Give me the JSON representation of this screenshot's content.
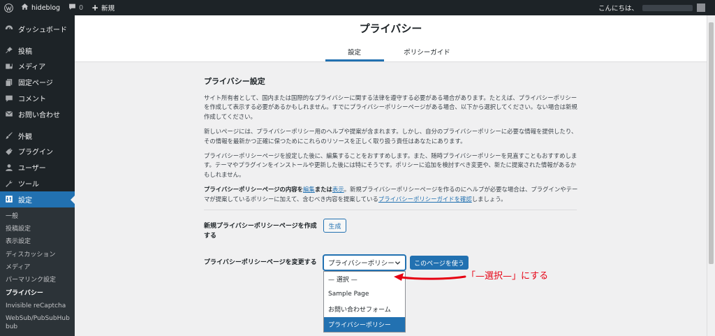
{
  "adminbar": {
    "site_name": "hideblog",
    "comments_count": "0",
    "new_label": "新規",
    "greeting": "こんにちは、"
  },
  "sidebar": {
    "items": [
      {
        "label": "ダッシュボード",
        "icon": "dashboard-icon"
      },
      {
        "label": "投稿",
        "icon": "pin-icon"
      },
      {
        "label": "メディア",
        "icon": "media-icon"
      },
      {
        "label": "固定ページ",
        "icon": "page-icon"
      },
      {
        "label": "コメント",
        "icon": "comment-icon"
      },
      {
        "label": "お問い合わせ",
        "icon": "mail-icon"
      },
      {
        "label": "外観",
        "icon": "brush-icon"
      },
      {
        "label": "プラグイン",
        "icon": "plugin-icon"
      },
      {
        "label": "ユーザー",
        "icon": "user-icon"
      },
      {
        "label": "ツール",
        "icon": "wrench-icon"
      },
      {
        "label": "設定",
        "icon": "settings-icon"
      }
    ],
    "submenu": [
      "一般",
      "投稿設定",
      "表示設定",
      "ディスカッション",
      "メディア",
      "パーマリンク設定",
      "プライバシー",
      "Invisible reCaptcha",
      "WebSub/PubSubHubbub"
    ]
  },
  "header": {
    "title": "プライバシー",
    "tabs": [
      "設定",
      "ポリシーガイド"
    ]
  },
  "content": {
    "section_title": "プライバシー設定",
    "p1": "サイト所有者として、国内または国際的なプライバシーに関する法律を遵守する必要がある場合があります。たとえば、プライバシーポリシーを作成して表示する必要があるかもしれません。すでにプライバシーポリシーページがある場合、以下から選択してください。ない場合は新規作成してください。",
    "p2": "新しいページには、プライバシーポリシー用のヘルプや提案が含まれます。しかし、自分のプライバシーポリシーに必要な情報を提供したり、その情報を最新かつ正確に保つためにこれらのリソースを正しく取り扱う責任はあなたにあります。",
    "p3": "プライバシーポリシーページを設定した後に、編集することをおすすめします。また、随時プライバシーポリシーを見直すこともおすすめします。テーマやプラグインをインストールや更新した後には特にそうです。ポリシーに追加を検討すべき変更や、新たに提案された情報があるかもしれません。",
    "p4_bold": "プライバシーポリシーページの内容を",
    "p4_link_edit": "編集",
    "p4_or": "または",
    "p4_link_view": "表示",
    "p4_rest": "。新規プライバシーポリシーページを作るのにヘルプが必要な場合は、プラグインやテーマが提案しているポリシーに加えて、含むべき内容を提案している",
    "p4_link_guide": "プライバシーポリシーガイドを確認",
    "p4_end": "しましょう。"
  },
  "form": {
    "create_label": "新規プライバシーポリシーページを作成する",
    "create_button": "生成",
    "change_label": "プライバシーポリシーページを変更する",
    "select_value": "プライバシーポリシー",
    "use_button": "このページを使う",
    "options": [
      "— 選択 —",
      "Sample Page",
      "お問い合わせフォーム",
      "プライバシーポリシー"
    ]
  },
  "annotation": {
    "text": "「—選択—」にする",
    "color": "#e60012"
  },
  "colors": {
    "accent": "#2271b1",
    "sidebar_bg": "#1d2327"
  }
}
